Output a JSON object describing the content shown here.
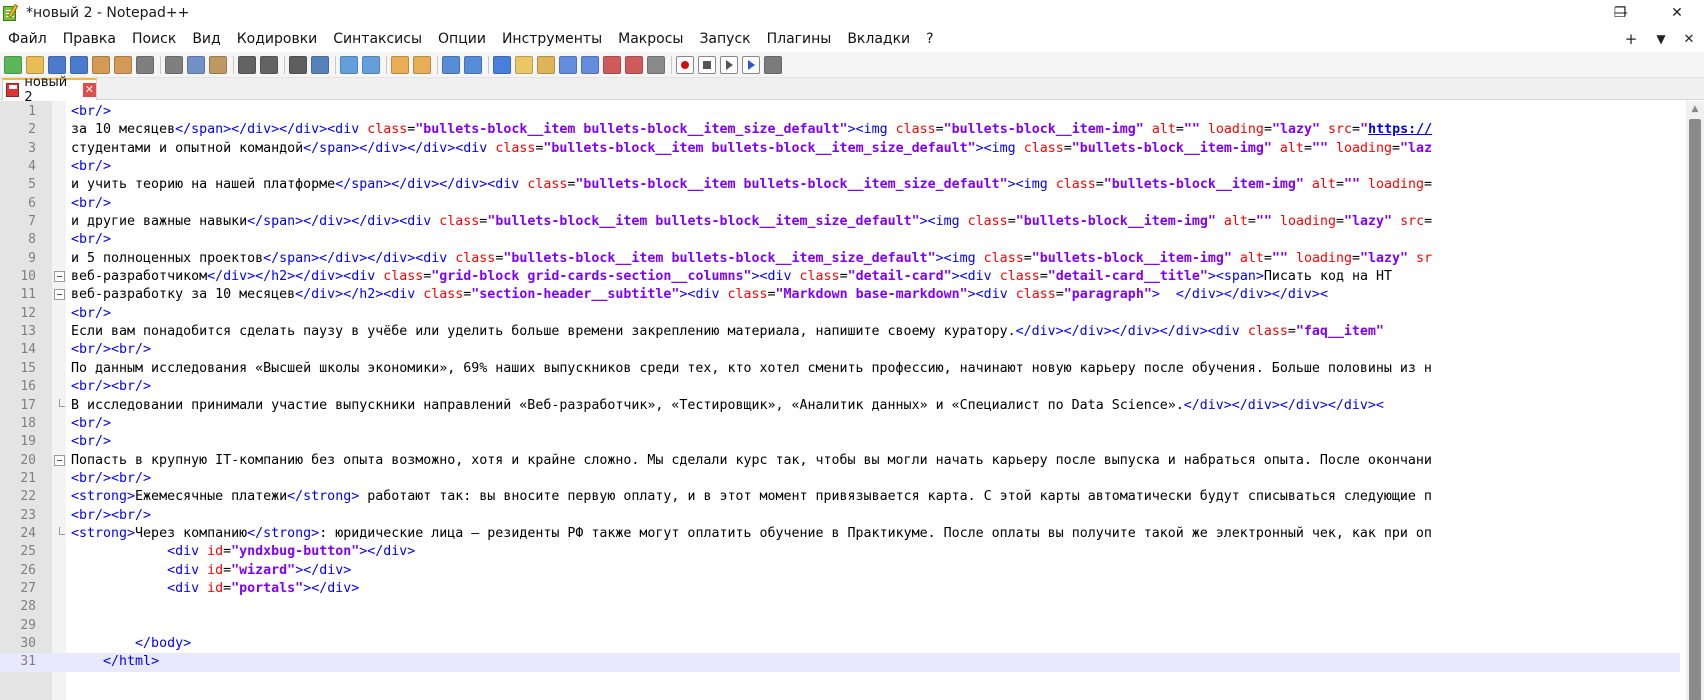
{
  "window": {
    "title": "*новый 2 - Notepad++",
    "controls": {
      "minimize": "—",
      "restore": "❐",
      "close": "✕"
    }
  },
  "menu": {
    "items": [
      "Файл",
      "Правка",
      "Поиск",
      "Вид",
      "Кодировки",
      "Синтаксисы",
      "Опции",
      "Инструменты",
      "Макросы",
      "Запуск",
      "Плагины",
      "Вкладки",
      "?"
    ],
    "right": {
      "add": "+",
      "dropdown": "▼",
      "close": "✕"
    }
  },
  "toolbar": {
    "colors": {
      "new": "#3fae3f",
      "open": "#e8b33b",
      "save": "#2f66c8",
      "saveall": "#2f66c8",
      "close": "#cf8a3a",
      "closeall": "#cf8a3a",
      "print": "#6b6b6b",
      "cut": "#6b6b6b",
      "copy": "#5a7fbf",
      "paste": "#b6884a",
      "undo": "#4a4a4a",
      "redo": "#4a4a4a",
      "find": "#444",
      "replace": "#3a6fb0",
      "zoomin": "#4a90d9",
      "zoomout": "#4a90d9",
      "sync_v": "#e6a13a",
      "sync_h": "#e6a13a",
      "wrap": "#3b7bd6",
      "allchars": "#3b7bd6",
      "indent": "#2b6ad9",
      "udl": "#e8c04b",
      "docmap": "#d9a93d",
      "funclist": "#4a7ad9",
      "folderws": "#4a7ad9",
      "monitor": "#c94040",
      "pdf": "#c94040",
      "bubble": "#777",
      "record": "#cc1111",
      "stop": "#555",
      "play": "#555",
      "playmulti": "#3355cc",
      "savemacro": "#666"
    }
  },
  "tab": {
    "label": "новый 2",
    "close": "✕"
  },
  "editor": {
    "lines": [
      {
        "n": "1",
        "fold": "",
        "s": [
          [
            "tag",
            "<br/>"
          ]
        ]
      },
      {
        "n": "2",
        "fold": "",
        "s": [
          [
            "text",
            "за 10 месяцев"
          ],
          [
            "tag",
            "</span></div></div><div "
          ],
          [
            "attr",
            "class"
          ],
          [
            "eq",
            "="
          ],
          [
            "val",
            "\"bullets-block__item bullets-block__item_size_default\""
          ],
          [
            "tag",
            "><img "
          ],
          [
            "attr",
            "class"
          ],
          [
            "eq",
            "="
          ],
          [
            "val",
            "\"bullets-block__item-img\""
          ],
          [
            "text",
            " "
          ],
          [
            "attr",
            "alt"
          ],
          [
            "eq",
            "="
          ],
          [
            "val",
            "\"\""
          ],
          [
            "text",
            " "
          ],
          [
            "attr",
            "loading"
          ],
          [
            "eq",
            "="
          ],
          [
            "val",
            "\"lazy\""
          ],
          [
            "text",
            " "
          ],
          [
            "attr",
            "src"
          ],
          [
            "eq",
            "="
          ],
          [
            "val",
            "\""
          ],
          [
            "url",
            "https://"
          ]
        ]
      },
      {
        "n": "3",
        "fold": "",
        "s": [
          [
            "text",
            "студентами и опытной командой"
          ],
          [
            "tag",
            "</span></div></div><div "
          ],
          [
            "attr",
            "class"
          ],
          [
            "eq",
            "="
          ],
          [
            "val",
            "\"bullets-block__item bullets-block__item_size_default\""
          ],
          [
            "tag",
            "><img "
          ],
          [
            "attr",
            "class"
          ],
          [
            "eq",
            "="
          ],
          [
            "val",
            "\"bullets-block__item-img\""
          ],
          [
            "text",
            " "
          ],
          [
            "attr",
            "alt"
          ],
          [
            "eq",
            "="
          ],
          [
            "val",
            "\"\""
          ],
          [
            "text",
            " "
          ],
          [
            "attr",
            "loading"
          ],
          [
            "eq",
            "="
          ],
          [
            "val",
            "\"laz"
          ]
        ]
      },
      {
        "n": "4",
        "fold": "",
        "s": [
          [
            "tag",
            "<br/>"
          ]
        ]
      },
      {
        "n": "5",
        "fold": "",
        "s": [
          [
            "text",
            "и учить теорию на нашей платформе"
          ],
          [
            "tag",
            "</span></div></div><div "
          ],
          [
            "attr",
            "class"
          ],
          [
            "eq",
            "="
          ],
          [
            "val",
            "\"bullets-block__item bullets-block__item_size_default\""
          ],
          [
            "tag",
            "><img "
          ],
          [
            "attr",
            "class"
          ],
          [
            "eq",
            "="
          ],
          [
            "val",
            "\"bullets-block__item-img\""
          ],
          [
            "text",
            " "
          ],
          [
            "attr",
            "alt"
          ],
          [
            "eq",
            "="
          ],
          [
            "val",
            "\"\""
          ],
          [
            "text",
            " "
          ],
          [
            "attr",
            "loading"
          ],
          [
            "eq",
            "="
          ]
        ]
      },
      {
        "n": "6",
        "fold": "",
        "s": [
          [
            "tag",
            "<br/>"
          ]
        ]
      },
      {
        "n": "7",
        "fold": "",
        "s": [
          [
            "text",
            "и другие важные навыки"
          ],
          [
            "tag",
            "</span></div></div><div "
          ],
          [
            "attr",
            "class"
          ],
          [
            "eq",
            "="
          ],
          [
            "val",
            "\"bullets-block__item bullets-block__item_size_default\""
          ],
          [
            "tag",
            "><img "
          ],
          [
            "attr",
            "class"
          ],
          [
            "eq",
            "="
          ],
          [
            "val",
            "\"bullets-block__item-img\""
          ],
          [
            "text",
            " "
          ],
          [
            "attr",
            "alt"
          ],
          [
            "eq",
            "="
          ],
          [
            "val",
            "\"\""
          ],
          [
            "text",
            " "
          ],
          [
            "attr",
            "loading"
          ],
          [
            "eq",
            "="
          ],
          [
            "val",
            "\"lazy\""
          ],
          [
            "text",
            " "
          ],
          [
            "attr",
            "src"
          ],
          [
            "eq",
            "="
          ]
        ]
      },
      {
        "n": "8",
        "fold": "",
        "s": [
          [
            "tag",
            "<br/>"
          ]
        ]
      },
      {
        "n": "9",
        "fold": "",
        "s": [
          [
            "text",
            "и 5 полноценных проектов"
          ],
          [
            "tag",
            "</span></div></div><div "
          ],
          [
            "attr",
            "class"
          ],
          [
            "eq",
            "="
          ],
          [
            "val",
            "\"bullets-block__item bullets-block__item_size_default\""
          ],
          [
            "tag",
            "><img "
          ],
          [
            "attr",
            "class"
          ],
          [
            "eq",
            "="
          ],
          [
            "val",
            "\"bullets-block__item-img\""
          ],
          [
            "text",
            " "
          ],
          [
            "attr",
            "alt"
          ],
          [
            "eq",
            "="
          ],
          [
            "val",
            "\"\""
          ],
          [
            "text",
            " "
          ],
          [
            "attr",
            "loading"
          ],
          [
            "eq",
            "="
          ],
          [
            "val",
            "\"lazy\""
          ],
          [
            "text",
            " "
          ],
          [
            "attr",
            "sr"
          ]
        ]
      },
      {
        "n": "10",
        "fold": "box",
        "s": [
          [
            "text",
            "веб-разработчиком"
          ],
          [
            "tag",
            "</div></h2></div><div "
          ],
          [
            "attr",
            "class"
          ],
          [
            "eq",
            "="
          ],
          [
            "val",
            "\"grid-block grid-cards-section__columns\""
          ],
          [
            "tag",
            "><div "
          ],
          [
            "attr",
            "class"
          ],
          [
            "eq",
            "="
          ],
          [
            "val",
            "\"detail-card\""
          ],
          [
            "tag",
            "><div "
          ],
          [
            "attr",
            "class"
          ],
          [
            "eq",
            "="
          ],
          [
            "val",
            "\"detail-card__title\""
          ],
          [
            "tag",
            "><span>"
          ],
          [
            "text",
            "Писать код на HT"
          ]
        ]
      },
      {
        "n": "11",
        "fold": "box",
        "s": [
          [
            "text",
            "веб-разработку за 10 месяцев"
          ],
          [
            "tag",
            "</div></h2><div "
          ],
          [
            "attr",
            "class"
          ],
          [
            "eq",
            "="
          ],
          [
            "val",
            "\"section-header__subtitle\""
          ],
          [
            "tag",
            "><div "
          ],
          [
            "attr",
            "class"
          ],
          [
            "eq",
            "="
          ],
          [
            "val",
            "\"Markdown base-markdown\""
          ],
          [
            "tag",
            "><div "
          ],
          [
            "attr",
            "class"
          ],
          [
            "eq",
            "="
          ],
          [
            "val",
            "\"paragraph\""
          ],
          [
            "tag",
            ">  </div></div></div><"
          ]
        ]
      },
      {
        "n": "12",
        "fold": "",
        "s": [
          [
            "tag",
            "<br/>"
          ]
        ]
      },
      {
        "n": "13",
        "fold": "",
        "s": [
          [
            "text",
            "Если вам понадобится сделать паузу в учёбе или уделить больше времени закреплению материала, напишите своему куратору."
          ],
          [
            "tag",
            "</div></div></div></div><div "
          ],
          [
            "attr",
            "class"
          ],
          [
            "eq",
            "="
          ],
          [
            "val",
            "\"faq__item\""
          ]
        ]
      },
      {
        "n": "14",
        "fold": "",
        "s": [
          [
            "tag",
            "<br/><br/>"
          ]
        ]
      },
      {
        "n": "15",
        "fold": "",
        "s": [
          [
            "text",
            "По данным исследования «Высшей школы экономики», 69% наших выпускников среди тех, кто хотел сменить профессию, начинают новую карьеру после обучения. Больше половины из н"
          ]
        ]
      },
      {
        "n": "16",
        "fold": "",
        "s": [
          [
            "tag",
            "<br/><br/>"
          ]
        ]
      },
      {
        "n": "17",
        "fold": "end",
        "s": [
          [
            "text",
            "В исследовании принимали участие выпускники направлений «Веб-разработчик», «Тестировщик», «Аналитик данных» и «Специалист по Data Science»."
          ],
          [
            "tag",
            "</div></div></div></div><"
          ]
        ]
      },
      {
        "n": "18",
        "fold": "",
        "s": [
          [
            "tag",
            "<br/>"
          ]
        ]
      },
      {
        "n": "19",
        "fold": "",
        "s": [
          [
            "tag",
            "<br/>"
          ]
        ]
      },
      {
        "n": "20",
        "fold": "box",
        "s": [
          [
            "text",
            "Попасть в крупную IT-компанию без опыта возможно, хотя и крайне сложно. Мы сделали курс так, чтобы вы могли начать карьеру после выпуска и набраться опыта. После окончани"
          ]
        ]
      },
      {
        "n": "21",
        "fold": "",
        "s": [
          [
            "tag",
            "<br/><br/>"
          ]
        ]
      },
      {
        "n": "22",
        "fold": "",
        "s": [
          [
            "tag",
            "<strong>"
          ],
          [
            "text",
            "Ежемесячные платежи"
          ],
          [
            "tag",
            "</strong>"
          ],
          [
            "text",
            " работают так: вы вносите первую оплату, и в этот момент привязывается карта. С этой карты автоматически будут списываться следующие п"
          ]
        ]
      },
      {
        "n": "23",
        "fold": "",
        "s": [
          [
            "tag",
            "<br/><br/>"
          ]
        ]
      },
      {
        "n": "24",
        "fold": "end",
        "s": [
          [
            "tag",
            "<strong>"
          ],
          [
            "text",
            "Через компанию"
          ],
          [
            "tag",
            "</strong>"
          ],
          [
            "text",
            ": юридические лица — резиденты РФ также могут оплатить обучение в Практикуме. После оплаты вы получите такой же электронный чек, как при оп"
          ]
        ]
      },
      {
        "n": "25",
        "fold": "",
        "s": [
          [
            "text",
            "            "
          ],
          [
            "tag",
            "<div "
          ],
          [
            "attr",
            "id"
          ],
          [
            "eq",
            "="
          ],
          [
            "val",
            "\"yndxbug-button\""
          ],
          [
            "tag",
            "></div>"
          ]
        ]
      },
      {
        "n": "26",
        "fold": "",
        "s": [
          [
            "text",
            "            "
          ],
          [
            "tag",
            "<div "
          ],
          [
            "attr",
            "id"
          ],
          [
            "eq",
            "="
          ],
          [
            "val",
            "\"wizard\""
          ],
          [
            "tag",
            "></div>"
          ]
        ]
      },
      {
        "n": "27",
        "fold": "",
        "s": [
          [
            "text",
            "            "
          ],
          [
            "tag",
            "<div "
          ],
          [
            "attr",
            "id"
          ],
          [
            "eq",
            "="
          ],
          [
            "val",
            "\"portals\""
          ],
          [
            "tag",
            "></div>"
          ]
        ]
      },
      {
        "n": "28",
        "fold": "",
        "s": []
      },
      {
        "n": "29",
        "fold": "",
        "s": []
      },
      {
        "n": "30",
        "fold": "",
        "s": [
          [
            "text",
            "        "
          ],
          [
            "tag",
            "</body>"
          ]
        ]
      },
      {
        "n": "31",
        "fold": "",
        "current": true,
        "s": [
          [
            "text",
            "    "
          ],
          [
            "tag",
            "</html>"
          ]
        ]
      }
    ]
  }
}
